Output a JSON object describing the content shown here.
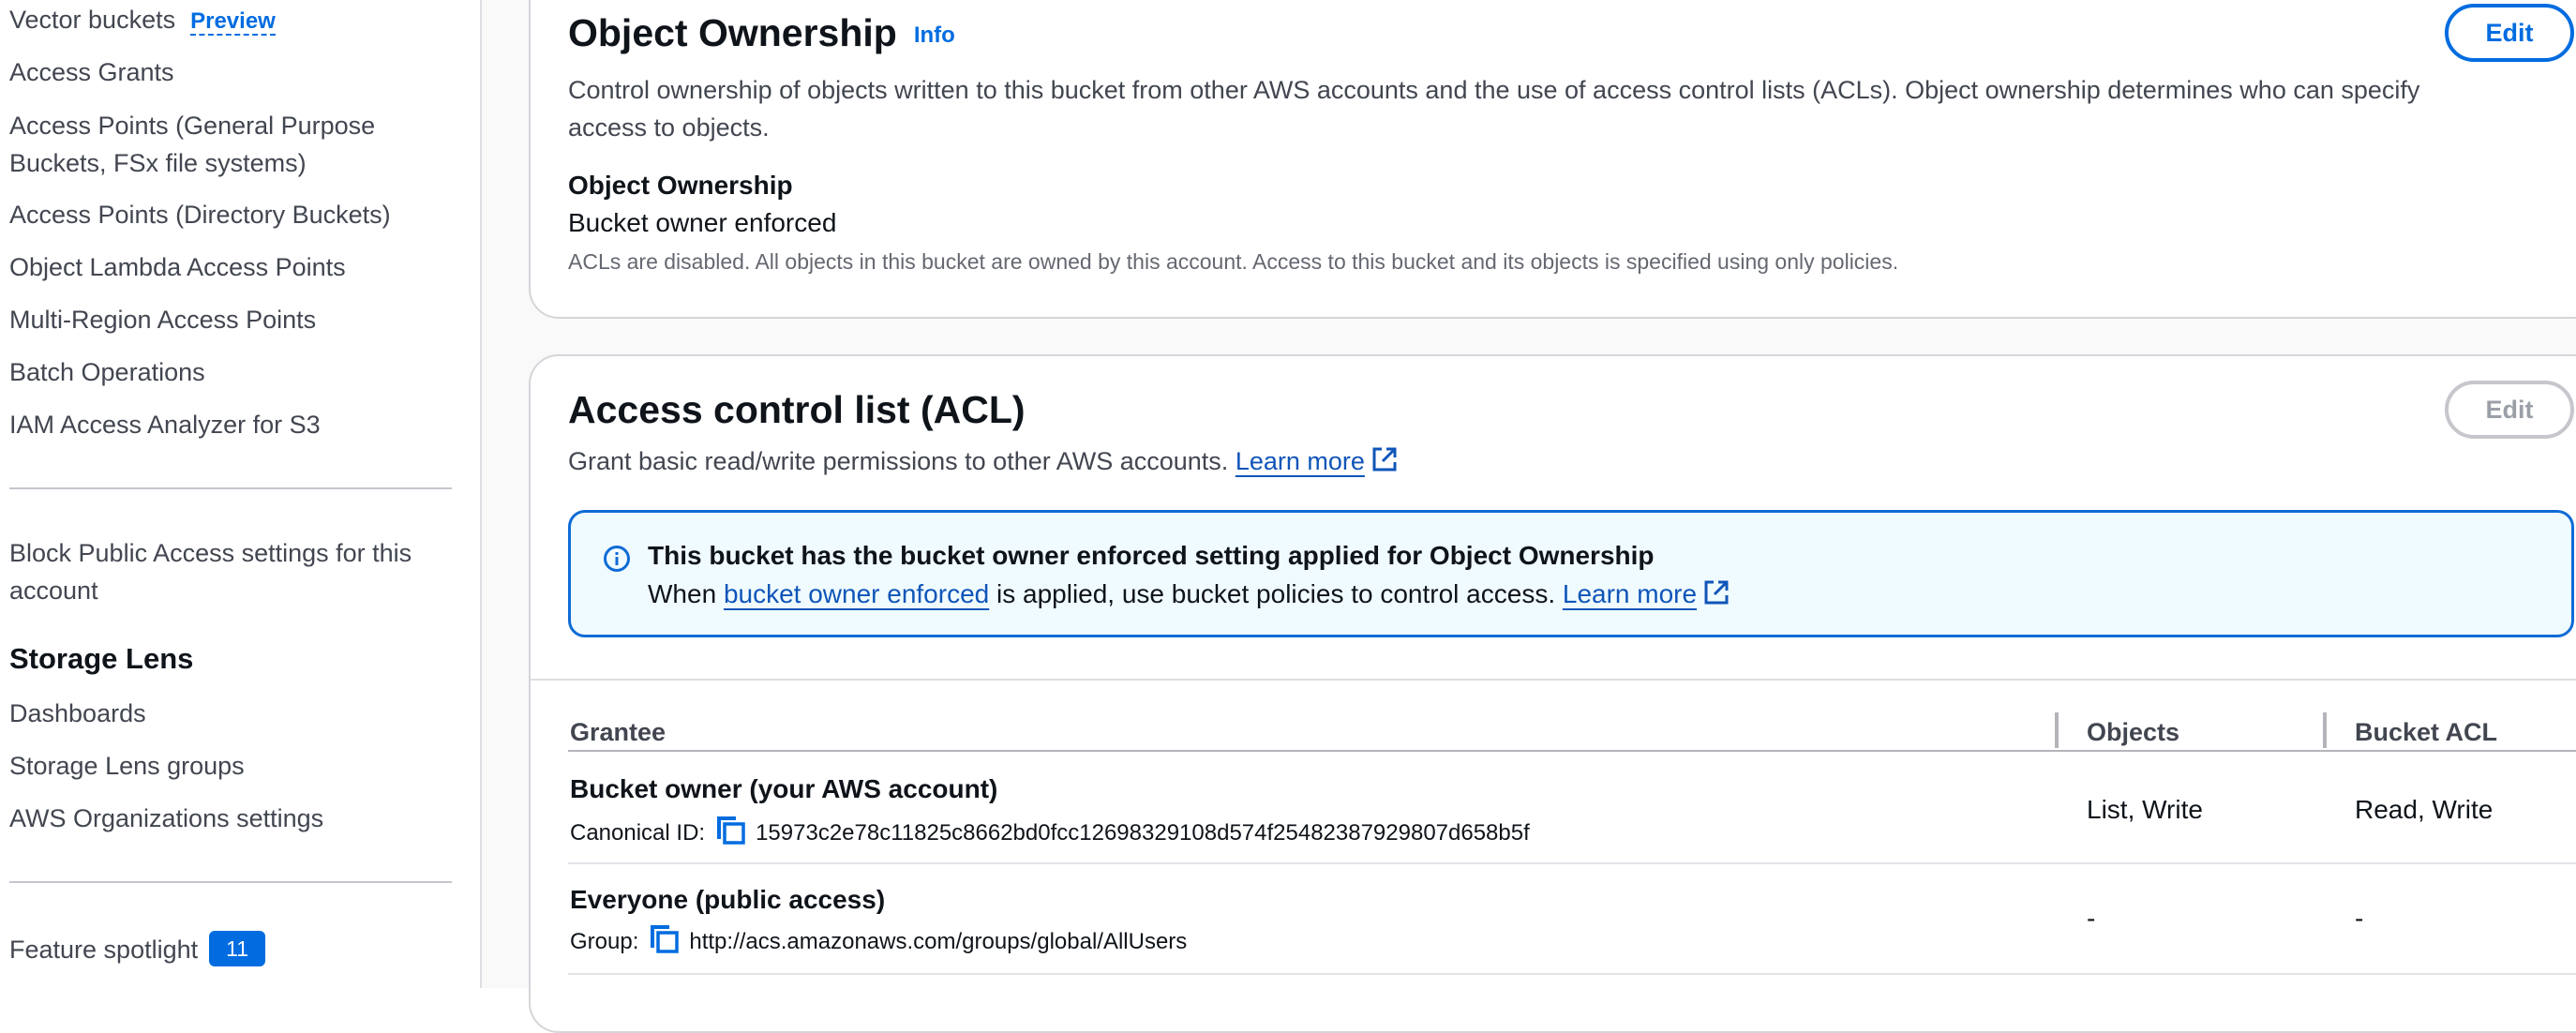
{
  "sidebar": {
    "vector_buckets": "Vector buckets",
    "preview_badge": "Preview",
    "access_grants": "Access Grants",
    "access_points_gp_line1": "Access Points (General Purpose",
    "access_points_gp_line2": "Buckets, FSx file systems)",
    "access_points_dir": "Access Points (Directory Buckets)",
    "object_lambda": "Object Lambda Access Points",
    "multi_region": "Multi-Region Access Points",
    "batch_operations": "Batch Operations",
    "iam_analyzer": "IAM Access Analyzer for S3",
    "block_public_line1": "Block Public Access settings for this",
    "block_public_line2": "account",
    "storage_lens": "Storage Lens",
    "dashboards": "Dashboards",
    "storage_lens_groups": "Storage Lens groups",
    "aws_org_settings": "AWS Organizations settings",
    "feature_spotlight": "Feature spotlight",
    "feature_spotlight_count": "11"
  },
  "ownership": {
    "title": "Object Ownership",
    "info": "Info",
    "edit": "Edit",
    "description_line1": "Control ownership of objects written to this bucket from other AWS accounts and the use of access control lists (ACLs). Object ownership determines who can specify",
    "description_line2": "access to objects.",
    "field_label": "Object Ownership",
    "field_value": "Bucket owner enforced",
    "field_note": "ACLs are disabled. All objects in this bucket are owned by this account. Access to this bucket and its objects is specified using only policies."
  },
  "acl": {
    "title": "Access control list (ACL)",
    "edit": "Edit",
    "description": "Grant basic read/write permissions to other AWS accounts.",
    "learn_more": "Learn more",
    "alert": {
      "title": "This bucket has the bucket owner enforced setting applied for Object Ownership",
      "body_prefix": "When",
      "body_link": "bucket owner enforced",
      "body_suffix": "is applied, use bucket policies to control access.",
      "learn_more": "Learn more"
    },
    "columns": {
      "grantee": "Grantee",
      "objects": "Objects",
      "bucket_acl": "Bucket ACL"
    },
    "rows": [
      {
        "grantee": "Bucket owner (your AWS account)",
        "id_label": "Canonical ID:",
        "id_value": "15973c2e78c11825c8662bd0fcc12698329108d574f25482387929807d658b5f",
        "objects": "List, Write",
        "bucket_acl": "Read, Write"
      },
      {
        "grantee": "Everyone (public access)",
        "id_label": "Group:",
        "id_value": "http://acs.amazonaws.com/groups/global/AllUsers",
        "objects": "-",
        "bucket_acl": "-"
      }
    ]
  },
  "colors": {
    "link": "#006ce0",
    "alert_border": "#0f6bd6",
    "alert_bg": "#f0fbff"
  }
}
